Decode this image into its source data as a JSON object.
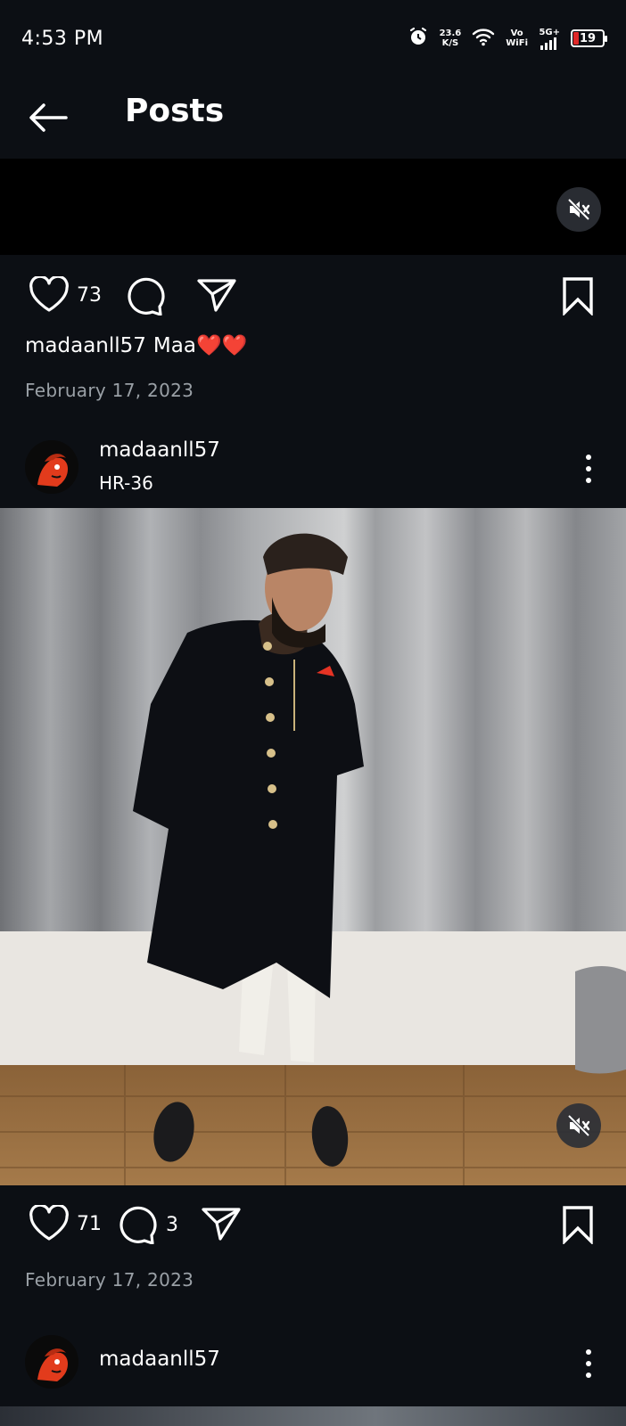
{
  "status_bar": {
    "time": "4:53 PM",
    "net_speed_top": "23.6",
    "net_speed_bottom": "K/S",
    "vowifi_top": "Vo",
    "vowifi_bottom": "WiFi",
    "network": "5G+",
    "battery": "19"
  },
  "app_bar": {
    "title": "Posts",
    "back_icon": "arrow-left-icon"
  },
  "post1": {
    "likes": "73",
    "caption_user": "madaanll57",
    "caption_text": "Maa",
    "caption_emoji": "❤️❤️",
    "date": "February 17, 2023"
  },
  "post2": {
    "username": "madaanll57",
    "location": "HR-36",
    "likes": "71",
    "comments": "3",
    "date": "February 17, 2023"
  },
  "post3": {
    "username": "madaanll57"
  },
  "colors": {
    "background": "#0c0f14",
    "date_gray": "#9aa0a6",
    "heart_red": "#e0202a",
    "battery_low": "#e02929"
  }
}
